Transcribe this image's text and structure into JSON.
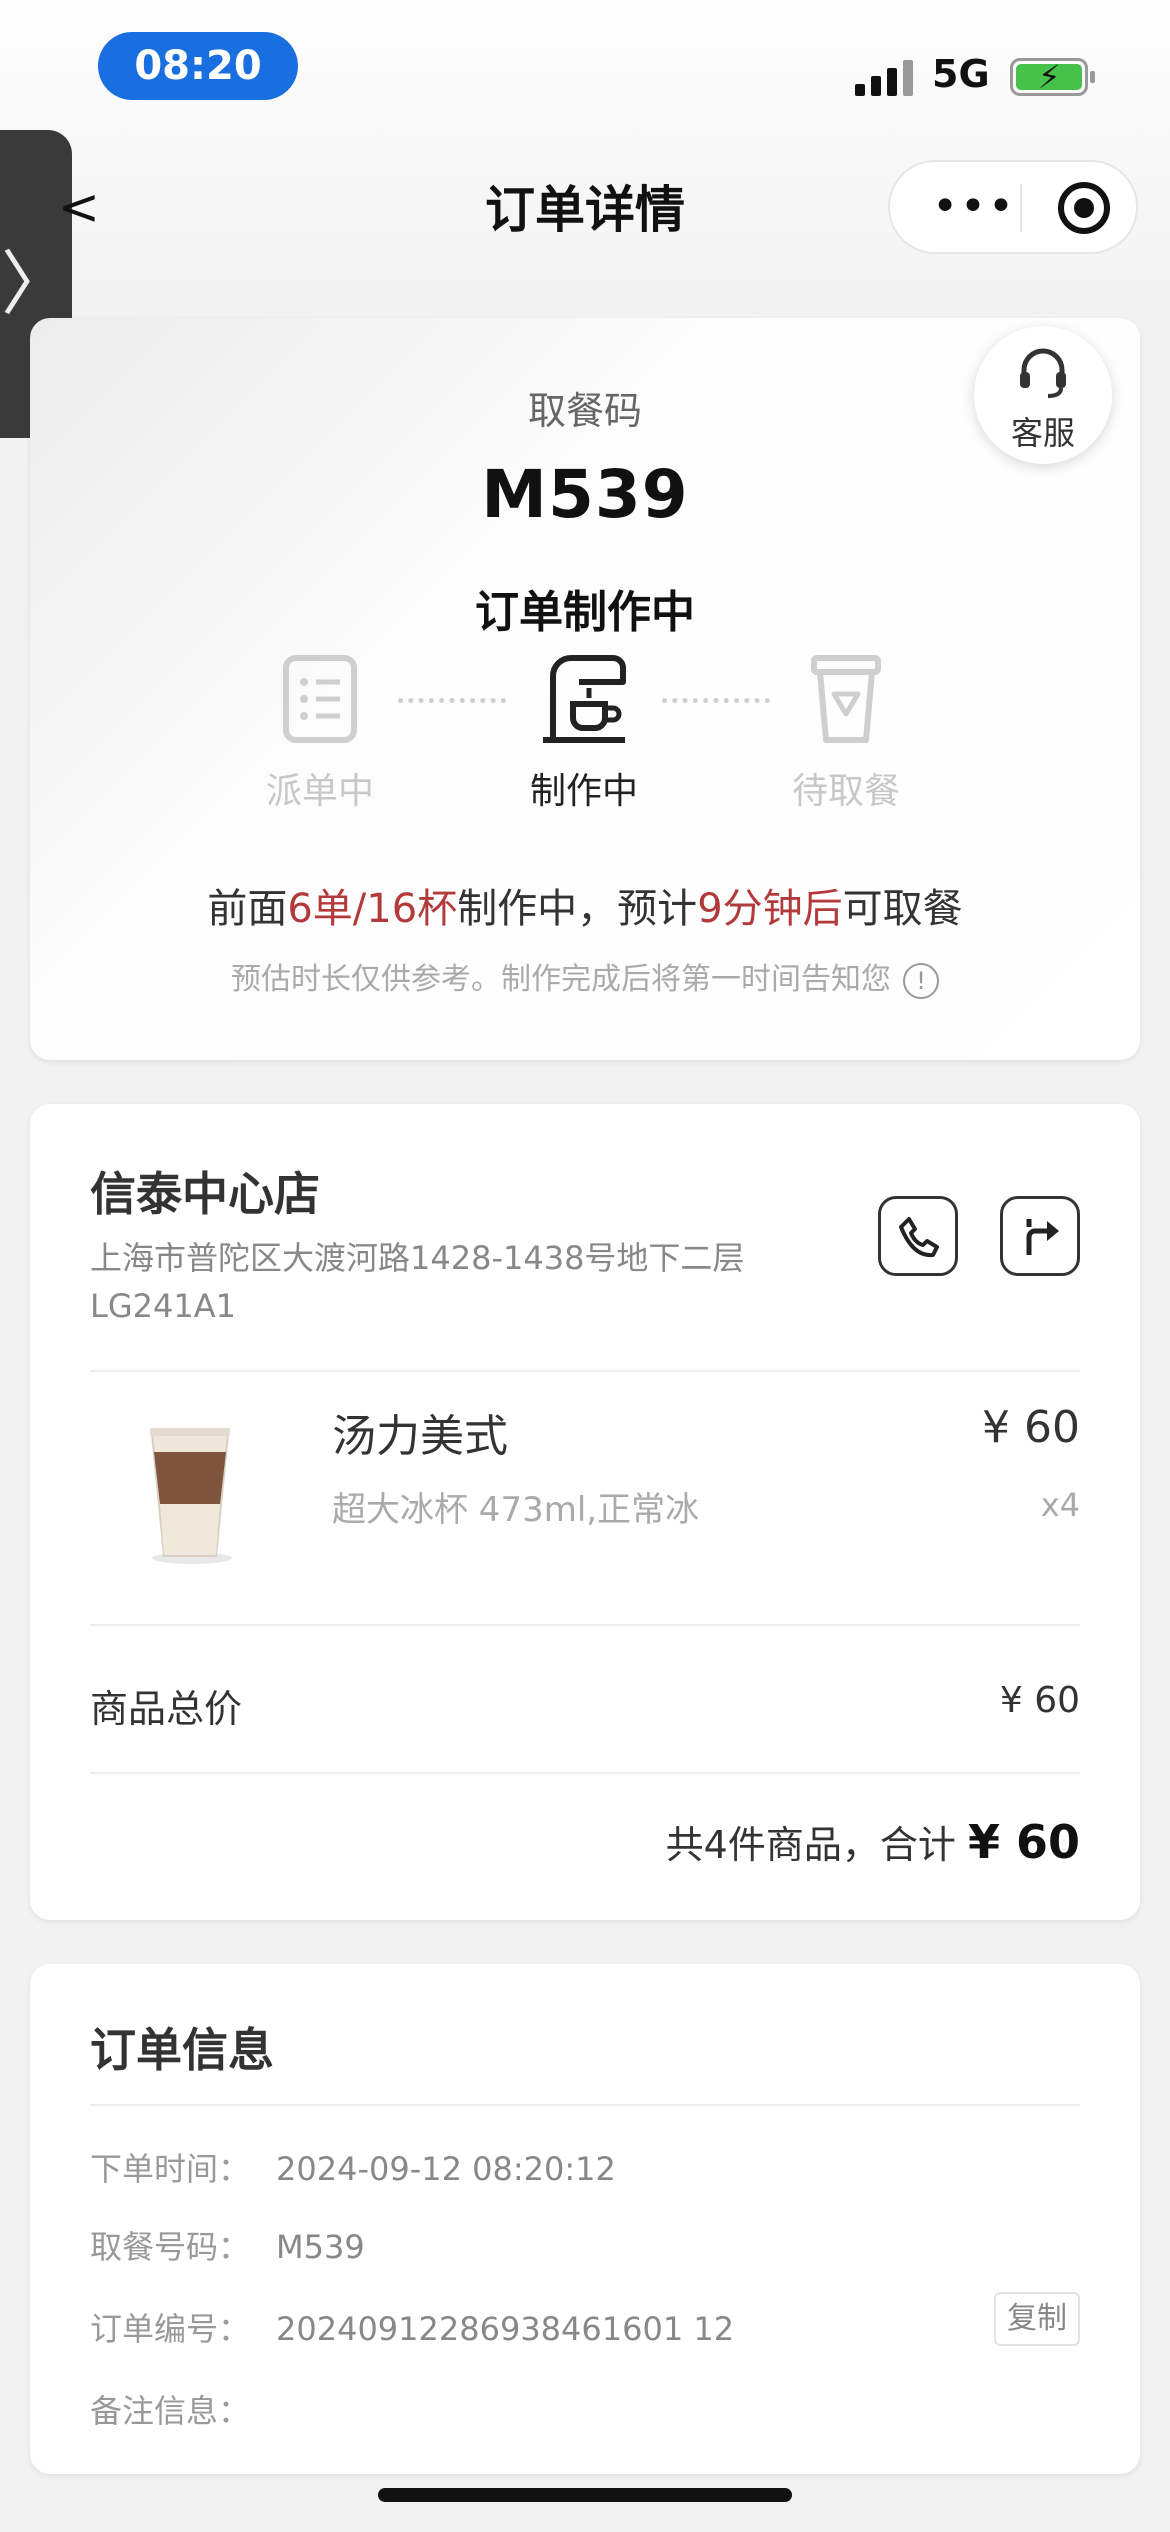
{
  "status_bar": {
    "time": "08:20",
    "network": "5G"
  },
  "nav": {
    "back": "<",
    "title": "订单详情",
    "more": "•••"
  },
  "side_tab": {
    "glyph": "〉"
  },
  "order_card": {
    "service_label": "客服",
    "pickup_label": "取餐码",
    "pickup_code": "M539",
    "status": "订单制作中",
    "steps": [
      {
        "label": "派单中",
        "state": "done"
      },
      {
        "label": "制作中",
        "state": "active"
      },
      {
        "label": "待取餐",
        "state": "pending"
      }
    ],
    "wait": {
      "p1": "前面",
      "orders": "6单/16杯",
      "p2": "制作中，预计",
      "minutes": "9分钟后",
      "p3": "可取餐"
    },
    "note": "预估时长仅供参考。制作完成后将第一时间告知您",
    "note_icon": "!"
  },
  "store": {
    "name": "信泰中心店",
    "address": "上海市普陀区大渡河路1428-1438号地下二层LG241A1"
  },
  "item": {
    "name": "汤力美式",
    "spec": "超大冰杯 473ml,正常冰",
    "price": "¥ 60",
    "qty": "x4"
  },
  "totals": {
    "subtotal_label": "商品总价",
    "subtotal_value": "¥ 60",
    "summary_text": "共4件商品，合计",
    "total": "¥ 60"
  },
  "order_info": {
    "title": "订单信息",
    "rows": [
      {
        "key": "下单时间：",
        "value": "2024-09-12 08:20:12"
      },
      {
        "key": "取餐号码：",
        "value": "M539"
      },
      {
        "key": "订单编号：",
        "value": "20240912286938461601 12"
      },
      {
        "key": "备注信息：",
        "value": ""
      }
    ],
    "copy_label": "复制"
  },
  "colors": {
    "accent": "#b33a3a",
    "time_pill": "#1a6fe0",
    "battery": "#46c24a"
  }
}
